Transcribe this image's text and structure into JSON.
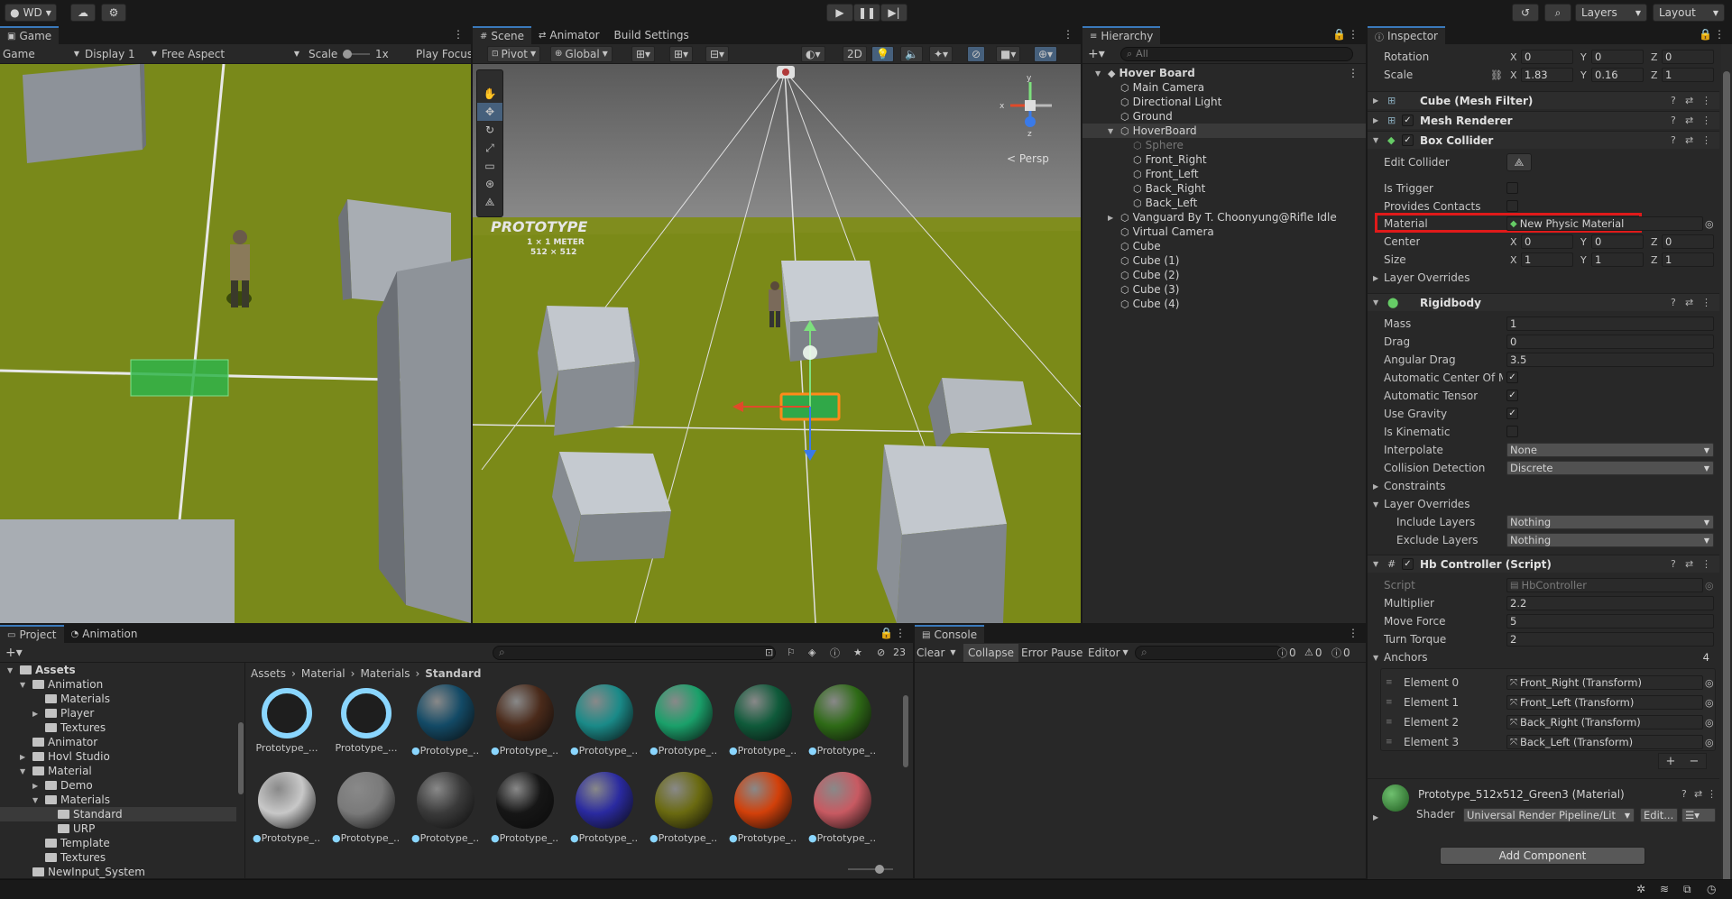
{
  "topbar": {
    "account": "WD",
    "play_icon": "play-icon",
    "pause_icon": "pause-icon",
    "step_icon": "step-icon",
    "layers": "Layers",
    "layout": "Layout"
  },
  "game": {
    "tab": "Game",
    "mode": "Game",
    "display": "Display 1",
    "aspect": "Free Aspect",
    "scale_label": "Scale",
    "scale_value": "1x",
    "play_focus": "Play Focus"
  },
  "scene": {
    "tabs": [
      "Scene",
      "Animator",
      "Build Settings"
    ],
    "pivot": "Pivot",
    "global": "Global",
    "mode2d": "2D",
    "persp": "< Persp",
    "prototype_text": "PROTOTYPE",
    "prototype_sub": "1 × 1 METER",
    "prototype_sub2": "512 × 512"
  },
  "hierarchy": {
    "tab": "Hierarchy",
    "search_placeholder": "All",
    "root": "Hover Board",
    "items": [
      "Main Camera",
      "Directional Light",
      "Ground",
      "HoverBoard",
      "Sphere",
      "Front_Right",
      "Front_Left",
      "Back_Right",
      "Back_Left",
      "Vanguard By T. Choonyung@Rifle Idle",
      "Virtual Camera",
      "Cube",
      "Cube (1)",
      "Cube (2)",
      "Cube (3)",
      "Cube (4)"
    ]
  },
  "inspector": {
    "tab": "Inspector",
    "rotation": {
      "label": "Rotation",
      "x": "0",
      "y": "0",
      "z": "0"
    },
    "scale": {
      "label": "Scale",
      "x": "1.83",
      "y": "0.16",
      "z": "1"
    },
    "comp_meshfilter": "Cube (Mesh Filter)",
    "comp_meshrenderer": "Mesh Renderer",
    "comp_boxcollider": "Box Collider",
    "edit_collider": "Edit Collider",
    "is_trigger": "Is Trigger",
    "provides_contacts": "Provides Contacts",
    "material_label": "Material",
    "material_value": "New Physic Material",
    "center": {
      "label": "Center",
      "x": "0",
      "y": "0",
      "z": "0"
    },
    "size": {
      "label": "Size",
      "x": "1",
      "y": "1",
      "z": "1"
    },
    "layer_overrides": "Layer Overrides",
    "comp_rigidbody": "Rigidbody",
    "mass": {
      "label": "Mass",
      "value": "1"
    },
    "drag": {
      "label": "Drag",
      "value": "0"
    },
    "angular_drag": {
      "label": "Angular Drag",
      "value": "3.5"
    },
    "auto_center": "Automatic Center Of Ma",
    "auto_tensor": "Automatic Tensor",
    "use_gravity": "Use Gravity",
    "is_kinematic": "Is Kinematic",
    "interpolate": {
      "label": "Interpolate",
      "value": "None"
    },
    "collision": {
      "label": "Collision Detection",
      "value": "Discrete"
    },
    "constraints": "Constraints",
    "layer_overrides2": "Layer Overrides",
    "include_layers": {
      "label": "Include Layers",
      "value": "Nothing"
    },
    "exclude_layers": {
      "label": "Exclude Layers",
      "value": "Nothing"
    },
    "comp_script": "Hb Controller (Script)",
    "script": {
      "label": "Script",
      "value": "HbController"
    },
    "multiplier": {
      "label": "Multiplier",
      "value": "2.2"
    },
    "move_force": {
      "label": "Move Force",
      "value": "5"
    },
    "turn_torque": {
      "label": "Turn Torque",
      "value": "2"
    },
    "anchors": {
      "label": "Anchors",
      "count": "4"
    },
    "elements": [
      {
        "label": "Element 0",
        "value": "Front_Right (Transform)"
      },
      {
        "label": "Element 1",
        "value": "Front_Left (Transform)"
      },
      {
        "label": "Element 2",
        "value": "Back_Right (Transform)"
      },
      {
        "label": "Element 3",
        "value": "Back_Left (Transform)"
      }
    ],
    "material_asset": "Prototype_512x512_Green3 (Material)",
    "shader_label": "Shader",
    "shader_value": "Universal Render Pipeline/Lit",
    "edit_btn": "Edit...",
    "add_component": "Add Component"
  },
  "project": {
    "tabs": [
      "Project",
      "Animation"
    ],
    "count": "23",
    "breadcrumb": [
      "Assets",
      "Material",
      "Materials",
      "Standard"
    ],
    "tree": [
      {
        "name": "Assets",
        "indent": 0,
        "arrow": "▼",
        "bold": true
      },
      {
        "name": "Animation",
        "indent": 1,
        "arrow": "▼"
      },
      {
        "name": "Materials",
        "indent": 2,
        "arrow": ""
      },
      {
        "name": "Player",
        "indent": 2,
        "arrow": "▶"
      },
      {
        "name": "Textures",
        "indent": 2,
        "arrow": ""
      },
      {
        "name": "Animator",
        "indent": 1,
        "arrow": ""
      },
      {
        "name": "Hovl Studio",
        "indent": 1,
        "arrow": "▶"
      },
      {
        "name": "Material",
        "indent": 1,
        "arrow": "▼"
      },
      {
        "name": "Demo",
        "indent": 2,
        "arrow": "▶"
      },
      {
        "name": "Materials",
        "indent": 2,
        "arrow": "▼"
      },
      {
        "name": "Standard",
        "indent": 3,
        "arrow": "",
        "selected": true
      },
      {
        "name": "URP",
        "indent": 3,
        "arrow": ""
      },
      {
        "name": "Template",
        "indent": 2,
        "arrow": ""
      },
      {
        "name": "Textures",
        "indent": 2,
        "arrow": ""
      },
      {
        "name": "NewInput_System",
        "indent": 1,
        "arrow": ""
      }
    ],
    "assets": [
      {
        "label": "Prototype_...",
        "color": "#8ad6ff",
        "type": "ring"
      },
      {
        "label": "Prototype_...",
        "color": "#8ad6ff",
        "type": "ring"
      },
      {
        "label": "Prototype_...",
        "color": "#134a66"
      },
      {
        "label": "Prototype_...",
        "color": "#4a2a1a"
      },
      {
        "label": "Prototype_...",
        "color": "#1a8a88"
      },
      {
        "label": "Prototype_...",
        "color": "#1aa06a"
      },
      {
        "label": "Prototype_...",
        "color": "#0f5a3a"
      },
      {
        "label": "Prototype_...",
        "color": "#2e6a16"
      },
      {
        "label": "Prototype_...",
        "color": "#c8c8c8"
      },
      {
        "label": "Prototype_...",
        "color": "#7a7a7a"
      },
      {
        "label": "Prototype_...",
        "color": "#3a3a3a"
      },
      {
        "label": "Prototype_...",
        "color": "#161616"
      },
      {
        "label": "Prototype_...",
        "color": "#2a2aa0"
      },
      {
        "label": "Prototype_...",
        "color": "#6a6a10"
      },
      {
        "label": "Prototype_...",
        "color": "#d2400a"
      },
      {
        "label": "Prototype_...",
        "color": "#c85a62"
      }
    ]
  },
  "console": {
    "tab": "Console",
    "clear": "Clear",
    "collapse": "Collapse",
    "error_pause": "Error Pause",
    "editor": "Editor",
    "c0": "0",
    "c1": "0",
    "c2": "0"
  }
}
